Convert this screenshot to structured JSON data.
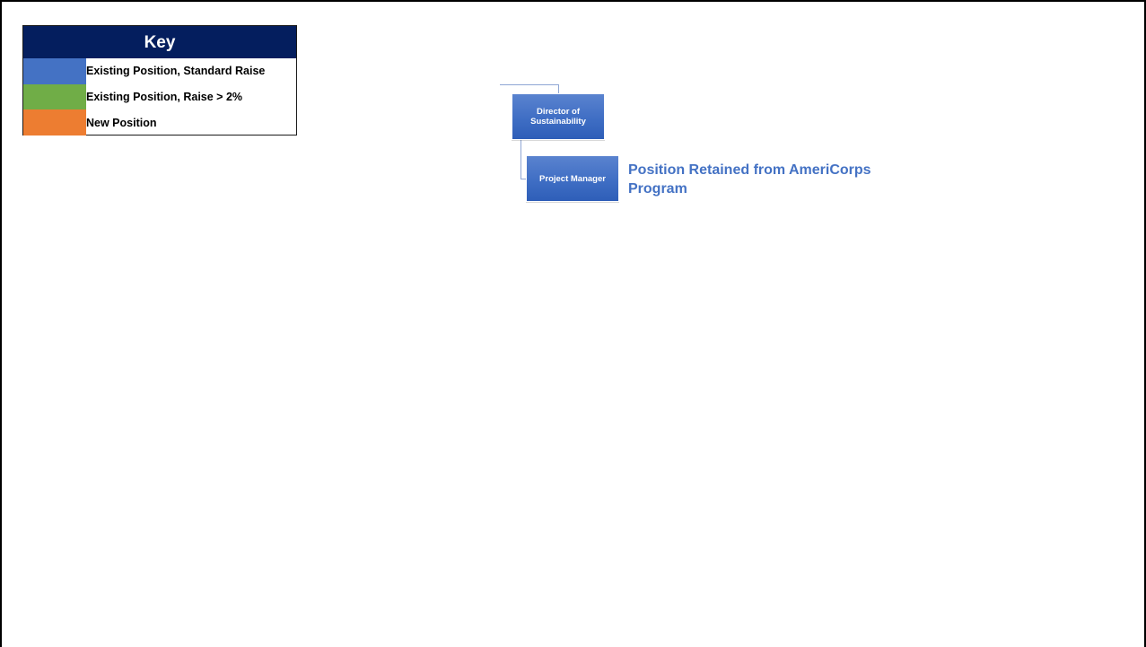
{
  "legend": {
    "title": "Key",
    "items": [
      {
        "label": "Existing Position, Standard Raise",
        "color": "#4472c4"
      },
      {
        "label": "Existing Position, Raise > 2%",
        "color": "#70ad47"
      },
      {
        "label": "New Position",
        "color": "#ed7d31"
      }
    ]
  },
  "org_chart": {
    "director": {
      "label": "Director of Sustainability",
      "color": "#4472c4"
    },
    "project_manager": {
      "label": "Project Manager",
      "color": "#4472c4"
    },
    "annotation": "Position Retained from AmeriCorps Program"
  },
  "colors": {
    "legend_header": "#041e5e",
    "connector": "#8fa6d4",
    "annotation_text": "#4472c4"
  }
}
